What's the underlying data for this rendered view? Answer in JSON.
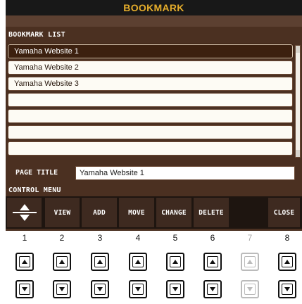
{
  "window": {
    "title": "BOOKMARK"
  },
  "bookmark_list": {
    "label": "BOOKMARK LIST",
    "items": [
      {
        "label": "Yamaha Website 1",
        "selected": true
      },
      {
        "label": "Yamaha Website 2",
        "selected": false
      },
      {
        "label": "Yamaha Website 3",
        "selected": false
      },
      {
        "label": "",
        "selected": false
      },
      {
        "label": "",
        "selected": false
      },
      {
        "label": "",
        "selected": false
      },
      {
        "label": "",
        "selected": false
      }
    ]
  },
  "page_title": {
    "label": "PAGE TITLE",
    "value": "Yamaha Website 1"
  },
  "control_menu": {
    "label": "CONTROL MENU",
    "buttons": [
      {
        "label": "",
        "icon": "up-down-arrows-icon"
      },
      {
        "label": "VIEW"
      },
      {
        "label": "ADD"
      },
      {
        "label": "MOVE"
      },
      {
        "label": "CHANGE"
      },
      {
        "label": "DELETE"
      },
      {
        "label": ""
      },
      {
        "label": "CLOSE"
      }
    ]
  },
  "hardware_buttons": {
    "numbers": [
      "1",
      "2",
      "3",
      "4",
      "5",
      "6",
      "7",
      "8"
    ],
    "disabled_index": 7
  },
  "colors": {
    "background": "#4b3021",
    "title_bar": "#181818",
    "title_text": "#e5ad2b",
    "selected_row": "#3c200f",
    "menu_button": "#3e2a20"
  }
}
